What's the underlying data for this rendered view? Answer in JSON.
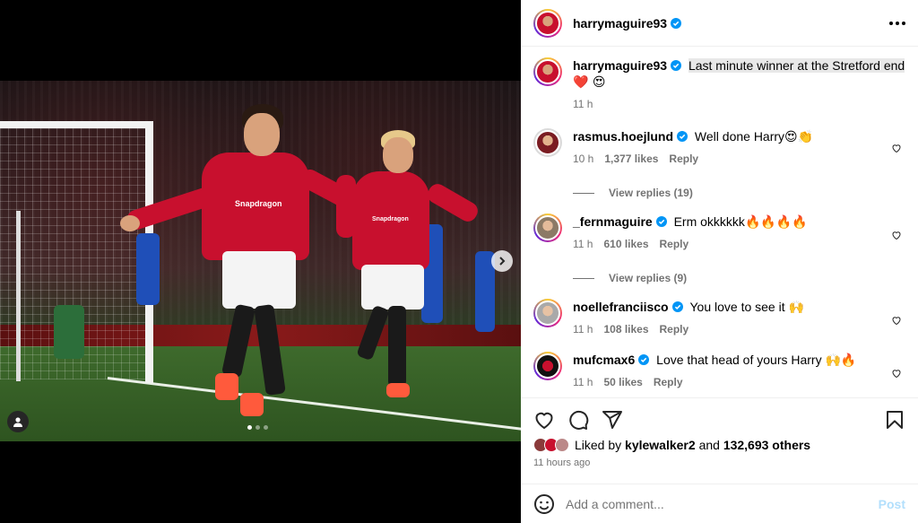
{
  "post": {
    "author": "harrymaguire93",
    "caption": "Last minute winner at the Stretford end",
    "caption_emoji": "❤️ 😍",
    "caption_time": "11 h",
    "likes_prefix": "Liked by",
    "liked_by_user": "kylewalker2",
    "likes_and": "and",
    "likes_others": "132,693 others",
    "posted_ago": "11 hours ago",
    "photo": {
      "sponsor_main": "Snapdragon",
      "sponsor_second": "Snapdragon"
    },
    "carousel": {
      "count": 3,
      "active": 0
    }
  },
  "comments": [
    {
      "user": "rasmus.hoejlund",
      "text": "Well done Harry",
      "emoji": "😍👏",
      "time": "10 h",
      "likes": "1,377 likes",
      "reply": "Reply",
      "view_replies": "View replies (19)"
    },
    {
      "user": "_fernmaguire",
      "text": "Erm okkkkkk",
      "emoji": "🔥🔥🔥🔥",
      "time": "11 h",
      "likes": "610 likes",
      "reply": "Reply",
      "view_replies": "View replies (9)"
    },
    {
      "user": "noellefranciisco",
      "text": "You love to see it",
      "emoji": "🙌",
      "time": "11 h",
      "likes": "108 likes",
      "reply": "Reply"
    },
    {
      "user": "mufcmax6",
      "text": "Love that head of yours Harry",
      "emoji": "🙌🔥",
      "time": "11 h",
      "likes": "50 likes",
      "reply": "Reply"
    },
    {
      "user": "dully_boosh",
      "text": "",
      "emoji": "🔥🔥👏"
    }
  ],
  "add_comment": {
    "placeholder": "Add a comment...",
    "post_label": "Post"
  },
  "colors": {
    "verified": "#0095f6",
    "post_disabled": "#b2dffc",
    "muted": "#737373"
  },
  "icons": [
    "more-icon",
    "heart-icon",
    "comment-icon",
    "share-icon",
    "save-icon",
    "emoji-icon",
    "verified-icon",
    "chevron-right-icon",
    "user-tag-icon"
  ]
}
